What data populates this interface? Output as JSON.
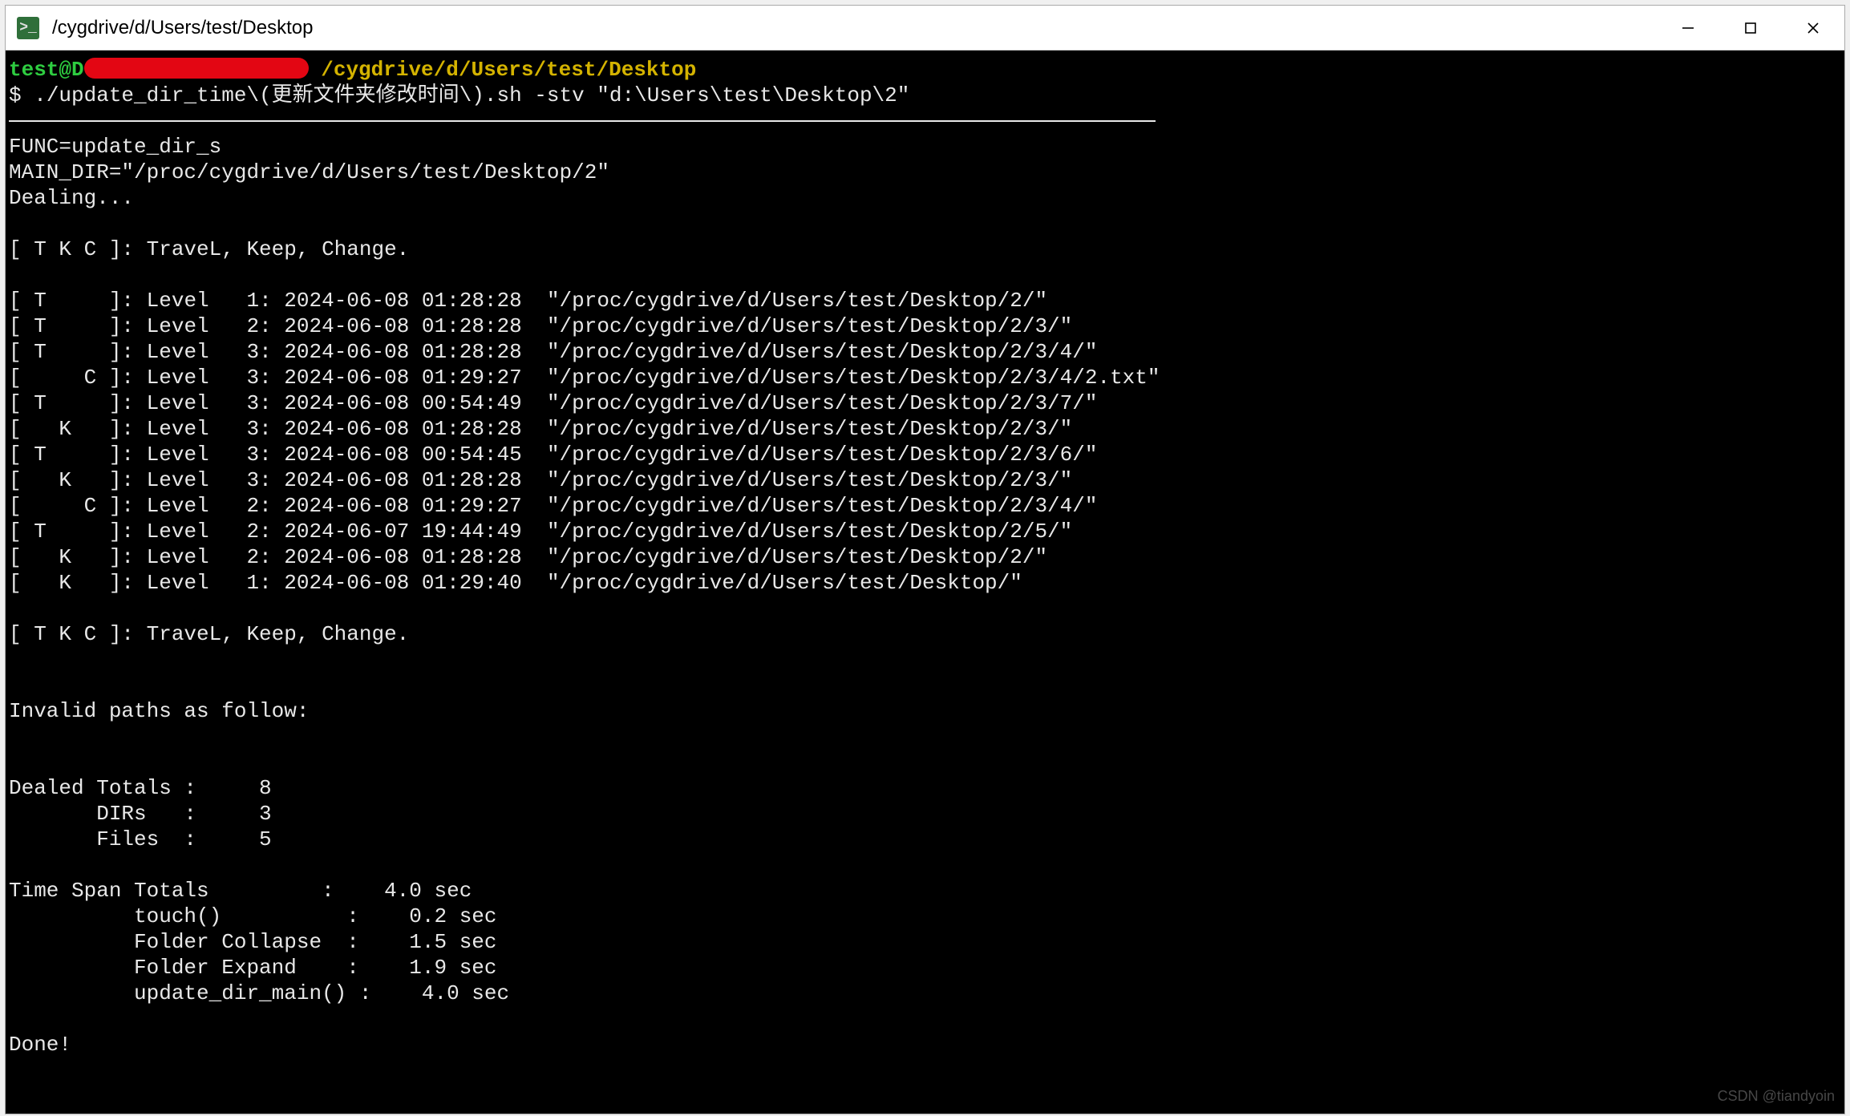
{
  "window": {
    "title": "/cygdrive/d/Users/test/Desktop"
  },
  "prompt": {
    "user": "test@D",
    "path": "/cygdrive/d/Users/test/Desktop",
    "symbol": "$ ",
    "command": "./update_dir_time\\(更新文件夹修改时间\\).sh -stv \"d:\\Users\\test\\Desktop\\2\""
  },
  "header": {
    "func": "FUNC=update_dir_s",
    "main_dir": "MAIN_DIR=\"/proc/cygdrive/d/Users/test/Desktop/2\"",
    "dealing": "Dealing..."
  },
  "legend": "[ T K C ]: TraveL, Keep, Change.",
  "rows": [
    {
      "flags": "[ T     ]:",
      "level": "Level   1:",
      "ts": "2024-06-08 01:28:28",
      "path": "\"/proc/cygdrive/d/Users/test/Desktop/2/\""
    },
    {
      "flags": "[ T     ]:",
      "level": "Level   2:",
      "ts": "2024-06-08 01:28:28",
      "path": "\"/proc/cygdrive/d/Users/test/Desktop/2/3/\""
    },
    {
      "flags": "[ T     ]:",
      "level": "Level   3:",
      "ts": "2024-06-08 01:28:28",
      "path": "\"/proc/cygdrive/d/Users/test/Desktop/2/3/4/\""
    },
    {
      "flags": "[     C ]:",
      "level": "Level   3:",
      "ts": "2024-06-08 01:29:27",
      "path": "\"/proc/cygdrive/d/Users/test/Desktop/2/3/4/2.txt\""
    },
    {
      "flags": "[ T     ]:",
      "level": "Level   3:",
      "ts": "2024-06-08 00:54:49",
      "path": "\"/proc/cygdrive/d/Users/test/Desktop/2/3/7/\""
    },
    {
      "flags": "[   K   ]:",
      "level": "Level   3:",
      "ts": "2024-06-08 01:28:28",
      "path": "\"/proc/cygdrive/d/Users/test/Desktop/2/3/\""
    },
    {
      "flags": "[ T     ]:",
      "level": "Level   3:",
      "ts": "2024-06-08 00:54:45",
      "path": "\"/proc/cygdrive/d/Users/test/Desktop/2/3/6/\""
    },
    {
      "flags": "[   K   ]:",
      "level": "Level   3:",
      "ts": "2024-06-08 01:28:28",
      "path": "\"/proc/cygdrive/d/Users/test/Desktop/2/3/\""
    },
    {
      "flags": "[     C ]:",
      "level": "Level   2:",
      "ts": "2024-06-08 01:29:27",
      "path": "\"/proc/cygdrive/d/Users/test/Desktop/2/3/4/\""
    },
    {
      "flags": "[ T     ]:",
      "level": "Level   2:",
      "ts": "2024-06-07 19:44:49",
      "path": "\"/proc/cygdrive/d/Users/test/Desktop/2/5/\""
    },
    {
      "flags": "[   K   ]:",
      "level": "Level   2:",
      "ts": "2024-06-08 01:28:28",
      "path": "\"/proc/cygdrive/d/Users/test/Desktop/2/\""
    },
    {
      "flags": "[   K   ]:",
      "level": "Level   1:",
      "ts": "2024-06-08 01:29:40",
      "path": "\"/proc/cygdrive/d/Users/test/Desktop/\""
    }
  ],
  "invalid": "Invalid paths as follow:",
  "summary": {
    "dealed": "Dealed Totals :     8",
    "dirs": "       DIRs   :     3",
    "files": "       Files  :     5"
  },
  "timing": {
    "total": "Time Span Totals         :    4.0 sec",
    "touch": "          touch()          :    0.2 sec",
    "collapse": "          Folder Collapse  :    1.5 sec",
    "expand": "          Folder Expand    :    1.9 sec",
    "main": "          update_dir_main() :    4.0 sec"
  },
  "done": "Done!",
  "watermark": "CSDN @tiandyoin"
}
